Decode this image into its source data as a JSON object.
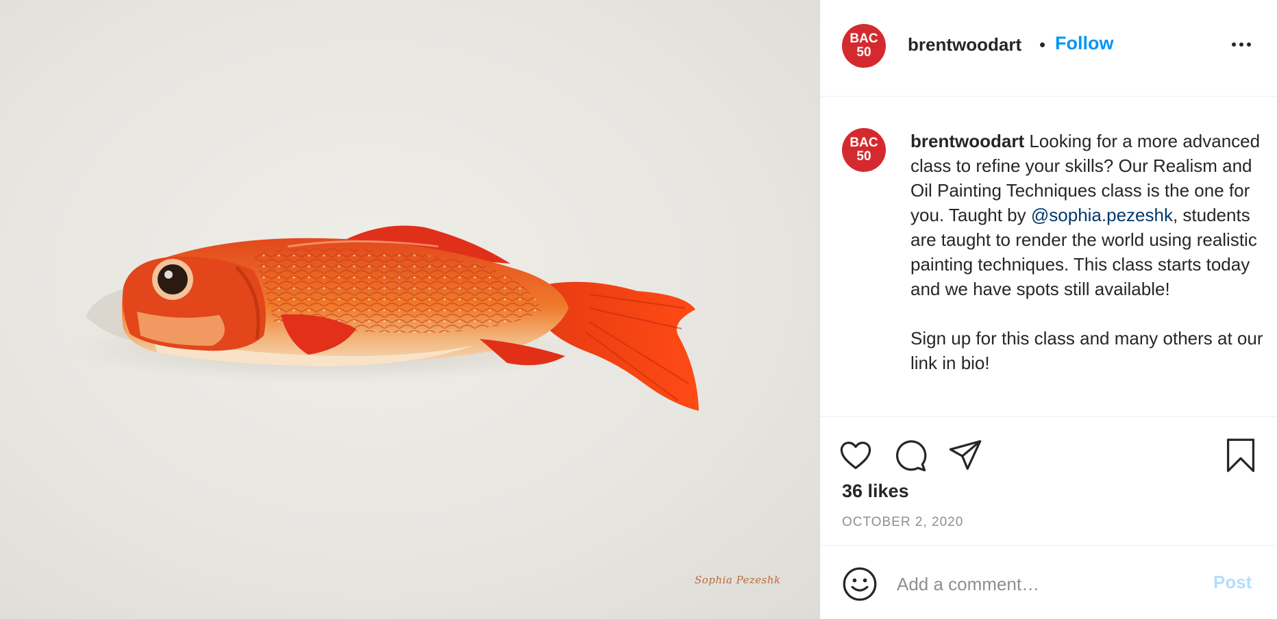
{
  "media": {
    "signature": "Sophia Pezeshk",
    "colors": {
      "background": "#e8e6e1",
      "fish": "#e8461a",
      "fin": "#e02a10"
    }
  },
  "header": {
    "avatar_line1": "BAC",
    "avatar_line2": "50",
    "username": "brentwoodart",
    "separator": "•",
    "follow_label": "Follow",
    "more_icon": "more-horizontal-icon"
  },
  "caption": {
    "avatar_line1": "BAC",
    "avatar_line2": "50",
    "username": "brentwoodart",
    "text_before_mention": " Looking for a more advanced class to refine your skills? Our Realism and Oil Painting Techniques class is the one for you. Taught by ",
    "mention": "@sophia.pezeshk",
    "text_after_mention": ", students are taught to render the world using realistic painting techniques. This class starts today and we have spots still available!",
    "second_paragraph": "Sign up for this class and many others at our link in bio!"
  },
  "actions": {
    "icons": [
      "heart-icon",
      "comment-icon",
      "share-icon",
      "bookmark-icon"
    ],
    "likes": "36 likes",
    "date": "OCTOBER 2, 2020"
  },
  "comment": {
    "emoji_icon": "emoji-icon",
    "placeholder": "Add a comment…",
    "post_label": "Post"
  },
  "colors": {
    "avatar": "#d42a2f",
    "follow": "#0095f6",
    "mention": "#00376b",
    "post_disabled": "#b2dffc",
    "muted": "#8e8e8e"
  }
}
